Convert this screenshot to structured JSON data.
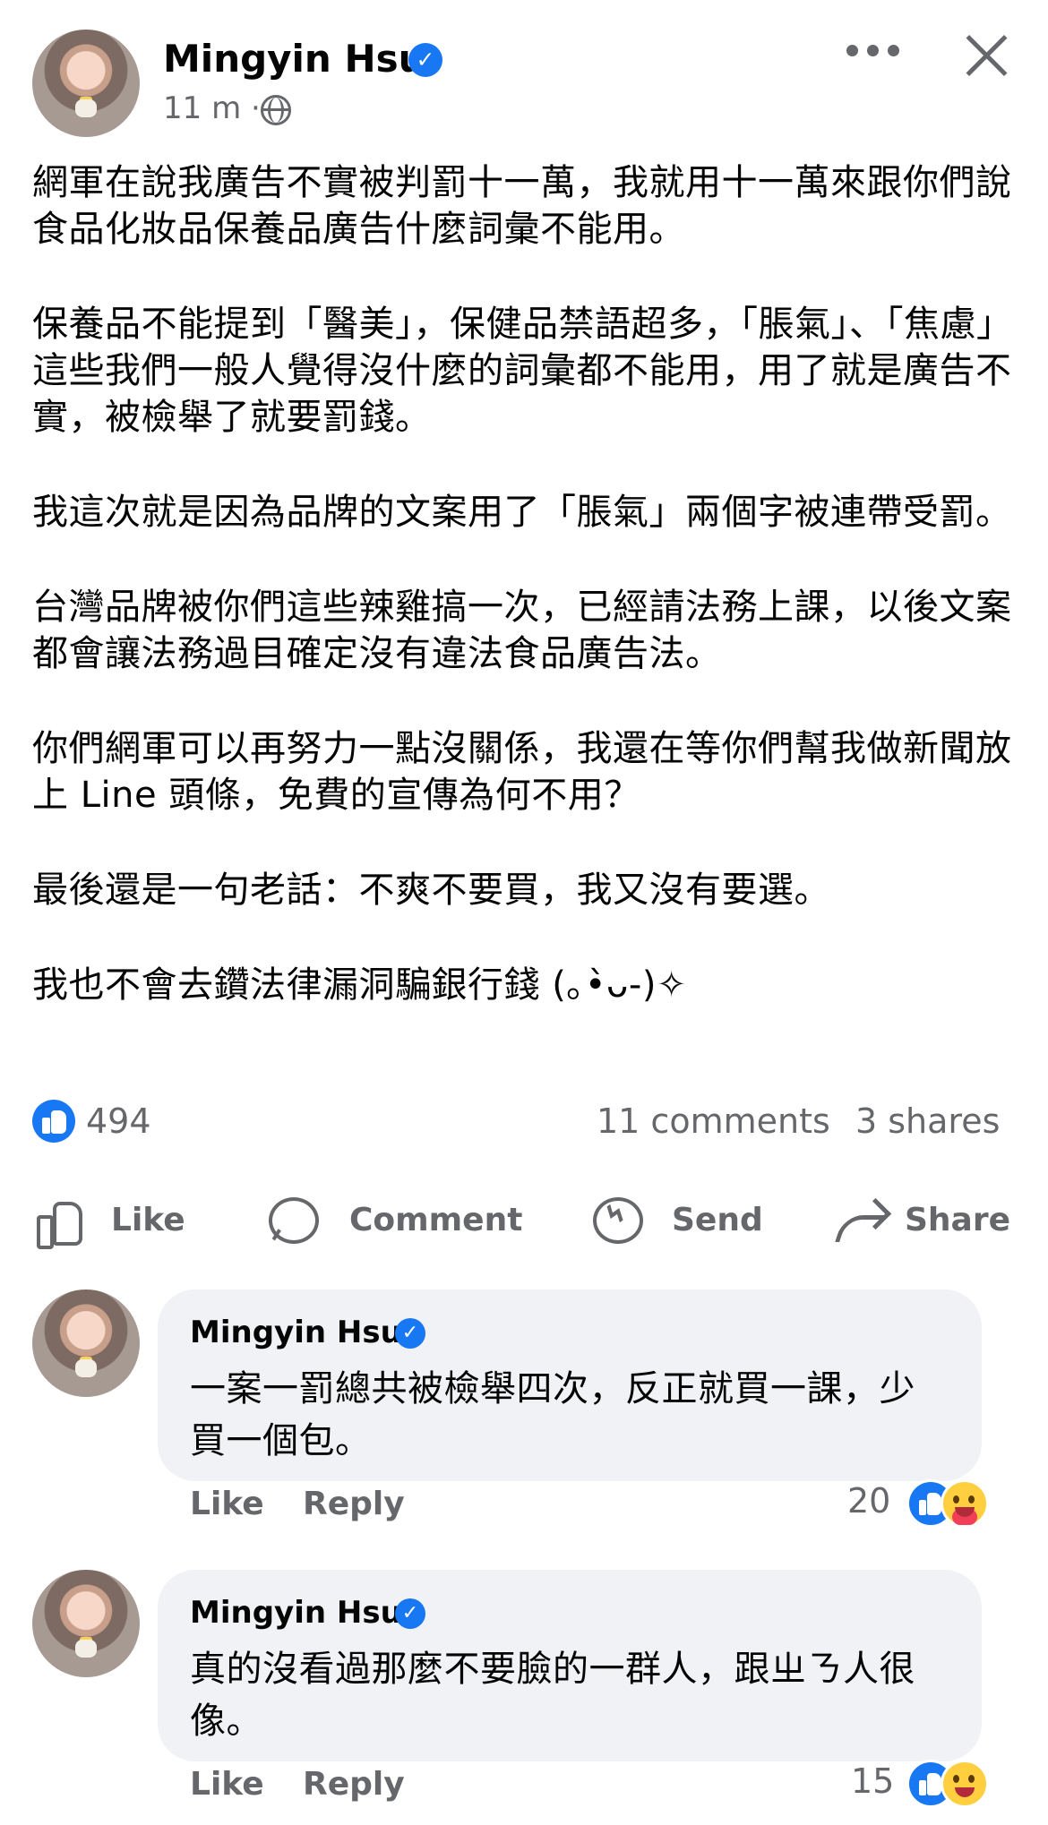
{
  "post": {
    "author": "Mingyin Hsu",
    "timestamp": "11 m",
    "separator": "·",
    "verified_symbol": "✓",
    "paragraphs": [
      "網軍在說我廣告不實被判罰十一萬，我就用十一萬來跟你們說食品化妝品保養品廣告什麼詞彙不能用。",
      "保養品不能提到「醫美」，保健品禁語超多，「脹氣」、「焦慮」這些我們一般人覺得沒什麼的詞彙都不能用，用了就是廣告不實，被檢舉了就要罰錢。",
      "我這次就是因為品牌的文案用了「脹氣」兩個字被連帶受罰。",
      "台灣品牌被你們這些辣雞搞一次，已經請法務上課，以後文案都會讓法務過目確定沒有違法食品廣告法。",
      "你們網軍可以再努力一點沒關係，我還在等你們幫我做新聞放上 Line 頭條，免費的宣傳為何不用？",
      "最後還是一句老話：不爽不要買，我又沒有要選。",
      "我也不會去鑽法律漏洞騙銀行錢 (｡•̀ᴗ-)✧"
    ],
    "stats": {
      "reactions": "494",
      "comments": "11 comments",
      "shares": "3 shares"
    },
    "actions": {
      "like": "Like",
      "comment": "Comment",
      "send": "Send",
      "share": "Share"
    }
  },
  "comments": [
    {
      "author": "Mingyin Hsu",
      "text": "一案一罰總共被檢舉四次，反正就買一課，少買一個包。",
      "like": "Like",
      "reply": "Reply",
      "reaction_count": "20",
      "reaction_icons": [
        "like-icon",
        "care-icon"
      ]
    },
    {
      "author": "Mingyin Hsu",
      "text": "真的沒看過那麼不要臉的一群人，跟ㄓㄋ人很像。",
      "like": "Like",
      "reply": "Reply",
      "reaction_count": "15",
      "reaction_icons": [
        "like-icon",
        "haha-icon"
      ]
    }
  ],
  "colors": {
    "facebook_blue": "#1877f2",
    "secondary_text": "#65676b",
    "comment_background": "#f0f2f5"
  }
}
